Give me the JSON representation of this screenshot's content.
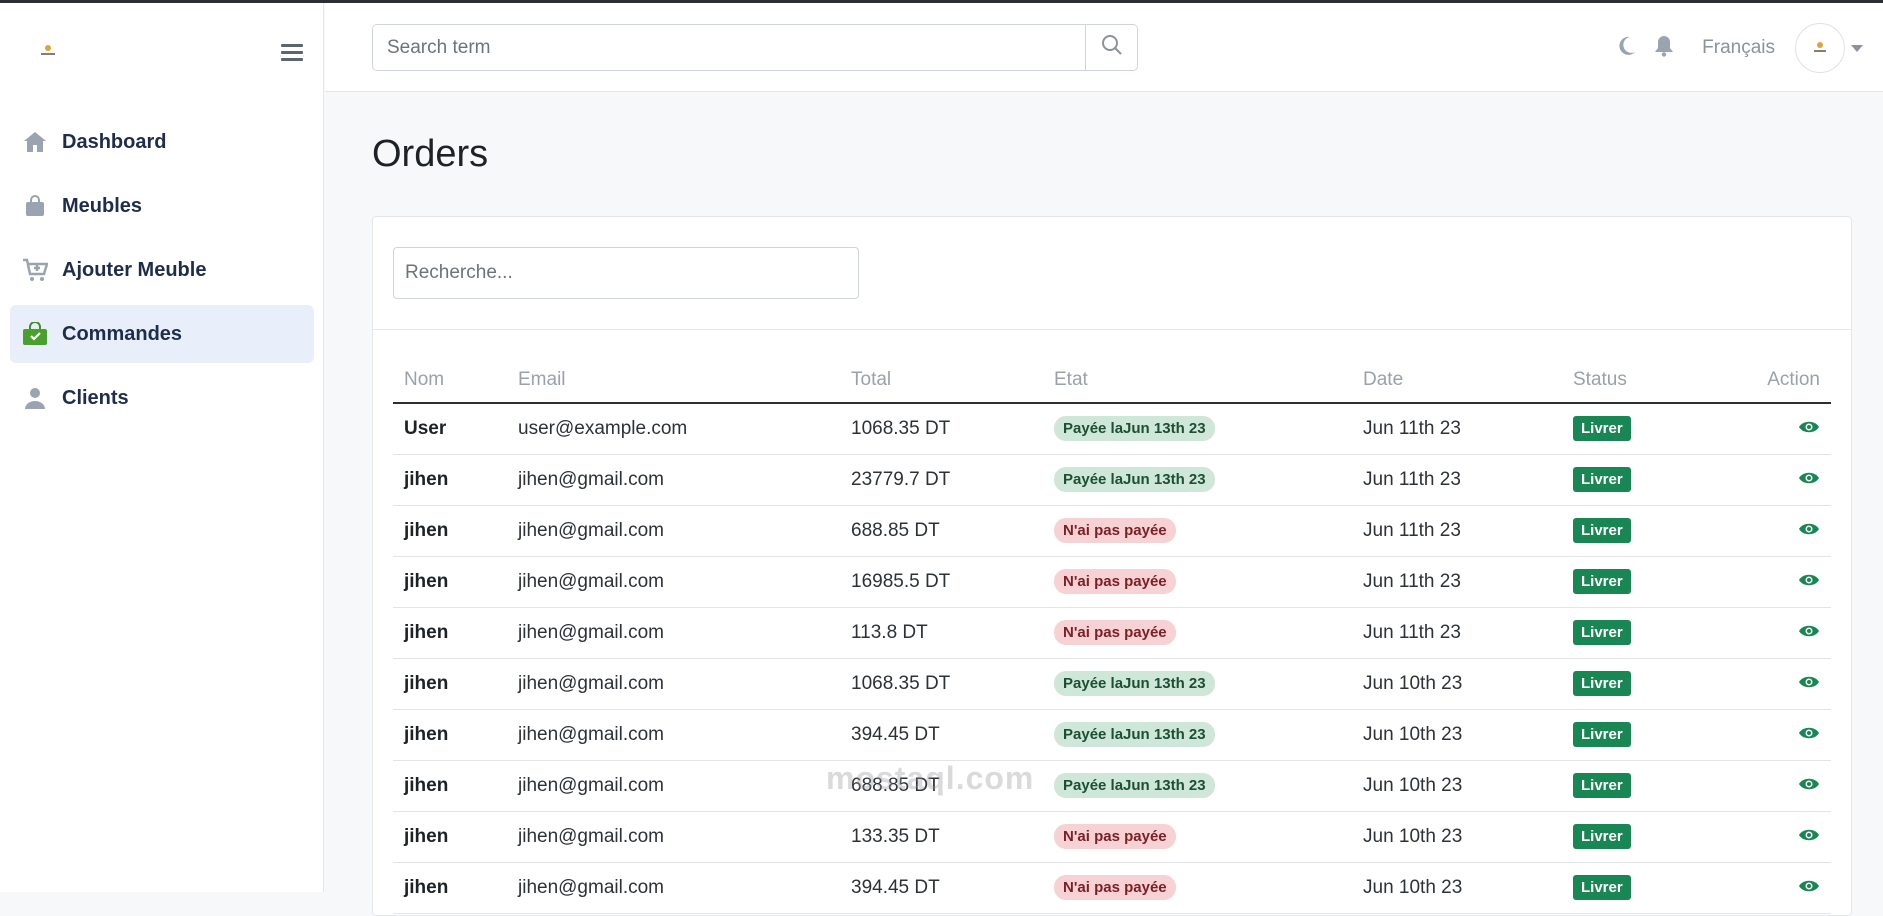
{
  "sidebar": {
    "items": [
      {
        "label": "Dashboard",
        "icon": "home-icon"
      },
      {
        "label": "Meubles",
        "icon": "bag-icon"
      },
      {
        "label": "Ajouter Meuble",
        "icon": "cart-plus-icon"
      },
      {
        "label": "Commandes",
        "icon": "shopping-bag-check-icon",
        "active": true
      },
      {
        "label": "Clients",
        "icon": "user-icon"
      }
    ]
  },
  "header": {
    "search_placeholder": "Search term",
    "language": "Français"
  },
  "page": {
    "title": "Orders",
    "search_placeholder": "Recherche..."
  },
  "table": {
    "headers": {
      "nom": "Nom",
      "email": "Email",
      "total": "Total",
      "etat": "Etat",
      "date": "Date",
      "status": "Status",
      "action": "Action"
    },
    "rows": [
      {
        "nom": "User",
        "email": "user@example.com",
        "total": "1068.35 DT",
        "etat": "Payée laJun 13th 23",
        "paid": true,
        "date": "Jun 11th 23",
        "status": "Livrer"
      },
      {
        "nom": "jihen",
        "email": "jihen@gmail.com",
        "total": "23779.7 DT",
        "etat": "Payée laJun 13th 23",
        "paid": true,
        "date": "Jun 11th 23",
        "status": "Livrer"
      },
      {
        "nom": "jihen",
        "email": "jihen@gmail.com",
        "total": "688.85 DT",
        "etat": "N'ai pas payée",
        "paid": false,
        "date": "Jun 11th 23",
        "status": "Livrer"
      },
      {
        "nom": "jihen",
        "email": "jihen@gmail.com",
        "total": "16985.5 DT",
        "etat": "N'ai pas payée",
        "paid": false,
        "date": "Jun 11th 23",
        "status": "Livrer"
      },
      {
        "nom": "jihen",
        "email": "jihen@gmail.com",
        "total": "113.8 DT",
        "etat": "N'ai pas payée",
        "paid": false,
        "date": "Jun 11th 23",
        "status": "Livrer"
      },
      {
        "nom": "jihen",
        "email": "jihen@gmail.com",
        "total": "1068.35 DT",
        "etat": "Payée laJun 13th 23",
        "paid": true,
        "date": "Jun 10th 23",
        "status": "Livrer"
      },
      {
        "nom": "jihen",
        "email": "jihen@gmail.com",
        "total": "394.45 DT",
        "etat": "Payée laJun 13th 23",
        "paid": true,
        "date": "Jun 10th 23",
        "status": "Livrer"
      },
      {
        "nom": "jihen",
        "email": "jihen@gmail.com",
        "total": "688.85 DT",
        "etat": "Payée laJun 13th 23",
        "paid": true,
        "date": "Jun 10th 23",
        "status": "Livrer"
      },
      {
        "nom": "jihen",
        "email": "jihen@gmail.com",
        "total": "133.35 DT",
        "etat": "N'ai pas payée",
        "paid": false,
        "date": "Jun 10th 23",
        "status": "Livrer"
      },
      {
        "nom": "jihen",
        "email": "jihen@gmail.com",
        "total": "394.45 DT",
        "etat": "N'ai pas payée",
        "paid": false,
        "date": "Jun 10th 23",
        "status": "Livrer"
      }
    ]
  },
  "watermark": "mostaql.com",
  "colors": {
    "accent": "#198754",
    "nav_active_bg": "#e8effa",
    "nav_text": "#1f2d4d"
  }
}
